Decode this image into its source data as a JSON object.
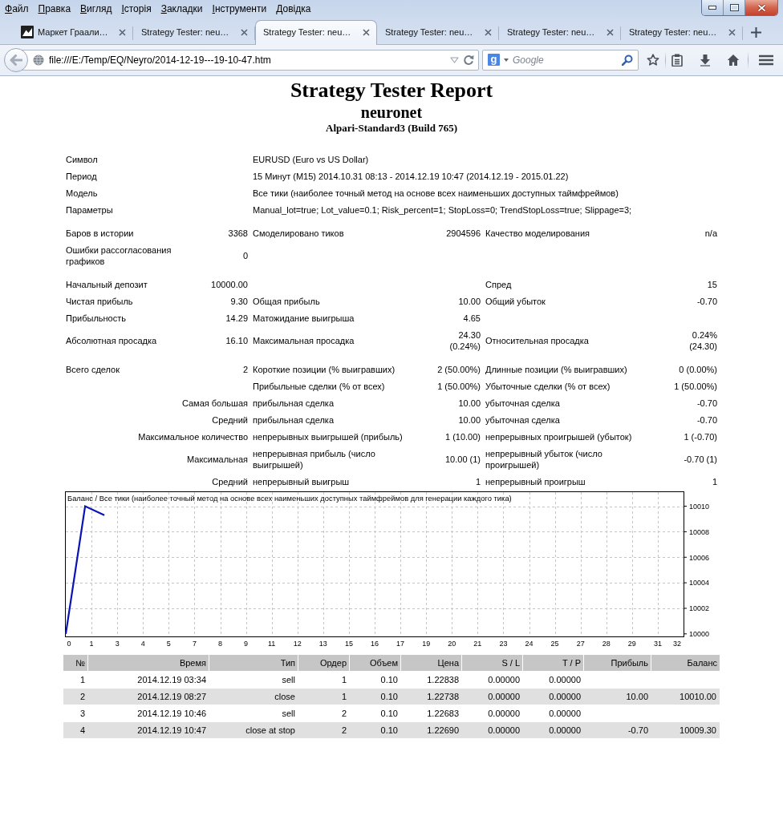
{
  "menu_bar": {
    "items": [
      "Файл",
      "Правка",
      "Вигляд",
      "Історія",
      "Закладки",
      "Інструменти",
      "Довідка"
    ]
  },
  "tabs": [
    {
      "title": "Маркет Граали…",
      "favicon": true,
      "selected": false
    },
    {
      "title": "Strategy Tester: neu…",
      "selected": false
    },
    {
      "title": "Strategy Tester: neu…",
      "selected": true
    },
    {
      "title": "Strategy Tester: neu…",
      "selected": false
    },
    {
      "title": "Strategy Tester: neu…",
      "selected": false
    },
    {
      "title": "Strategy Tester: neu…",
      "selected": false
    }
  ],
  "toolbar": {
    "back_button": {
      "disabled": true
    },
    "url": "file:///E:/Temp/EQ/Neyro/2014-12-19---19-10-47.htm",
    "search": {
      "engine_logo": "g",
      "placeholder": "Google"
    }
  },
  "report": {
    "title": "Strategy Tester Report",
    "expert": "neuronet",
    "server": "Alpari-Standard3 (Build 765)",
    "info": [
      {
        "label": "Символ",
        "value": "EURUSD (Euro vs US Dollar)"
      },
      {
        "label": "Период",
        "value": "15 Минут (M15) 2014.10.31 08:13 - 2014.12.19 10:47 (2014.12.19 - 2015.01.22)"
      },
      {
        "label": "Модель",
        "value": "Все тики (наиболее точный метод на основе всех наименьших доступных таймфреймов)"
      },
      {
        "label": "Параметры",
        "value": "Manual_lot=true; Lot_value=0.1; Risk_percent=1; StopLoss=0; TrendStopLoss=true; Slippage=3;"
      }
    ],
    "sections": [
      [
        {
          "cells": [
            {
              "label": "Баров в истории",
              "value": "3368"
            },
            {
              "label": "Смоделировано тиков",
              "value": "2904596"
            },
            {
              "label": "Качество моделирования",
              "value": "n/a"
            }
          ]
        },
        {
          "cells": [
            {
              "label": "Ошибки рассогласования графиков",
              "value": "0"
            }
          ]
        }
      ],
      [
        {
          "cells": [
            {
              "label": "Начальный депозит",
              "value": "10000.00"
            },
            null,
            {
              "label": "Спред",
              "value": "15"
            }
          ]
        },
        {
          "cells": [
            {
              "label": "Чистая прибыль",
              "value": "9.30"
            },
            {
              "label": "Общая прибыль",
              "value": "10.00"
            },
            {
              "label": "Общий убыток",
              "value": "-0.70"
            }
          ]
        },
        {
          "cells": [
            {
              "label": "Прибыльность",
              "value": "14.29"
            },
            {
              "label": "Матожидание выигрыша",
              "value": "4.65"
            }
          ]
        },
        {
          "cells": [
            {
              "label": "Абсолютная просадка",
              "value": "16.10"
            },
            {
              "label": "Максимальная просадка",
              "value": "24.30 (0.24%)"
            },
            {
              "label": "Относительная просадка",
              "value": "0.24% (24.30)"
            }
          ]
        }
      ],
      [
        {
          "cells": [
            {
              "label": "Всего сделок",
              "value": "2"
            },
            {
              "label": "Короткие позиции (% выигравших)",
              "value": "2 (50.00%)"
            },
            {
              "label": "Длинные позиции (% выигравших)",
              "value": "0 (0.00%)"
            }
          ]
        },
        {
          "cells": [
            null,
            {
              "label": "Прибыльные сделки (% от всех)",
              "value": "1 (50.00%)"
            },
            {
              "label": "Убыточные сделки (% от всех)",
              "value": "1 (50.00%)"
            }
          ]
        },
        {
          "heading": "Самая большая",
          "cells": [
            {
              "label": "прибыльная сделка",
              "value": "10.00"
            },
            {
              "label": "убыточная сделка",
              "value": "-0.70"
            }
          ]
        },
        {
          "heading": "Средний",
          "cells": [
            {
              "label": "прибыльная сделка",
              "value": "10.00"
            },
            {
              "label": "убыточная сделка",
              "value": "-0.70"
            }
          ]
        },
        {
          "heading": "Максимальное количество",
          "cells": [
            {
              "label": "непрерывных выигрышей (прибыль)",
              "value": "1 (10.00)"
            },
            {
              "label": "непрерывных проигрышей (убыток)",
              "value": "1 (-0.70)"
            }
          ]
        },
        {
          "heading": "Максимальная",
          "cells": [
            {
              "label": "непрерывная прибыль (число выигрышей)",
              "value": "10.00 (1)"
            },
            {
              "label": "непрерывный убыток (число проигрышей)",
              "value": "-0.70 (1)"
            }
          ]
        },
        {
          "heading": "Средний",
          "cells": [
            {
              "label": "непрерывный выигрыш",
              "value": "1"
            },
            {
              "label": "непрерывный проигрыш",
              "value": "1"
            }
          ]
        }
      ]
    ],
    "chart": {
      "chart_data": {
        "type": "line",
        "title": "Баланс / Все тики (наиболее точный метод на основе всех наименьших доступных таймфреймов для генерации каждого тика)",
        "x": [
          0,
          1,
          2
        ],
        "values": [
          10000,
          10010,
          10009.3
        ],
        "xlim": [
          0,
          32
        ],
        "ylim": [
          9999.8,
          10011.1
        ],
        "xticks": [
          0,
          {
            "value": 1.33,
            "label": "1"
          },
          {
            "value": 2.67,
            "label": "3"
          },
          4,
          {
            "value": 5.33,
            "label": "5"
          },
          {
            "value": 6.67,
            "label": "7"
          },
          8,
          {
            "value": 9.33,
            "label": "9"
          },
          {
            "value": 10.67,
            "label": "11"
          },
          12,
          {
            "value": 13.33,
            "label": "13"
          },
          {
            "value": 14.67,
            "label": "15"
          },
          16,
          {
            "value": 17.33,
            "label": "17"
          },
          {
            "value": 18.67,
            "label": "19"
          },
          20,
          {
            "value": 21.33,
            "label": "21"
          },
          {
            "value": 22.67,
            "label": "23"
          },
          24,
          {
            "value": 25.33,
            "label": "25"
          },
          {
            "value": 26.67,
            "label": "27"
          },
          28,
          {
            "value": 29.33,
            "label": "29"
          },
          {
            "value": 30.67,
            "label": "31"
          },
          32
        ],
        "yticks": [
          10000,
          10002,
          10004,
          10006,
          10008,
          10010
        ],
        "grid": true
      }
    },
    "trades": {
      "columns": [
        "№",
        "Время",
        "Тип",
        "Ордер",
        "Объем",
        "Цена",
        "S / L",
        "T / P",
        "Прибыль",
        "Баланс"
      ],
      "rows": [
        [
          "1",
          "2014.12.19 03:34",
          "sell",
          "1",
          "0.10",
          "1.22838",
          "0.00000",
          "0.00000",
          null,
          null
        ],
        [
          "2",
          "2014.12.19 08:27",
          "close",
          "1",
          "0.10",
          "1.22738",
          "0.00000",
          "0.00000",
          "10.00",
          "10010.00"
        ],
        [
          "3",
          "2014.12.19 10:46",
          "sell",
          "2",
          "0.10",
          "1.22683",
          "0.00000",
          "0.00000",
          null,
          null
        ],
        [
          "4",
          "2014.12.19 10:47",
          "close at stop",
          "2",
          "0.10",
          "1.22690",
          "0.00000",
          "0.00000",
          "-0.70",
          "10009.30"
        ]
      ]
    }
  }
}
